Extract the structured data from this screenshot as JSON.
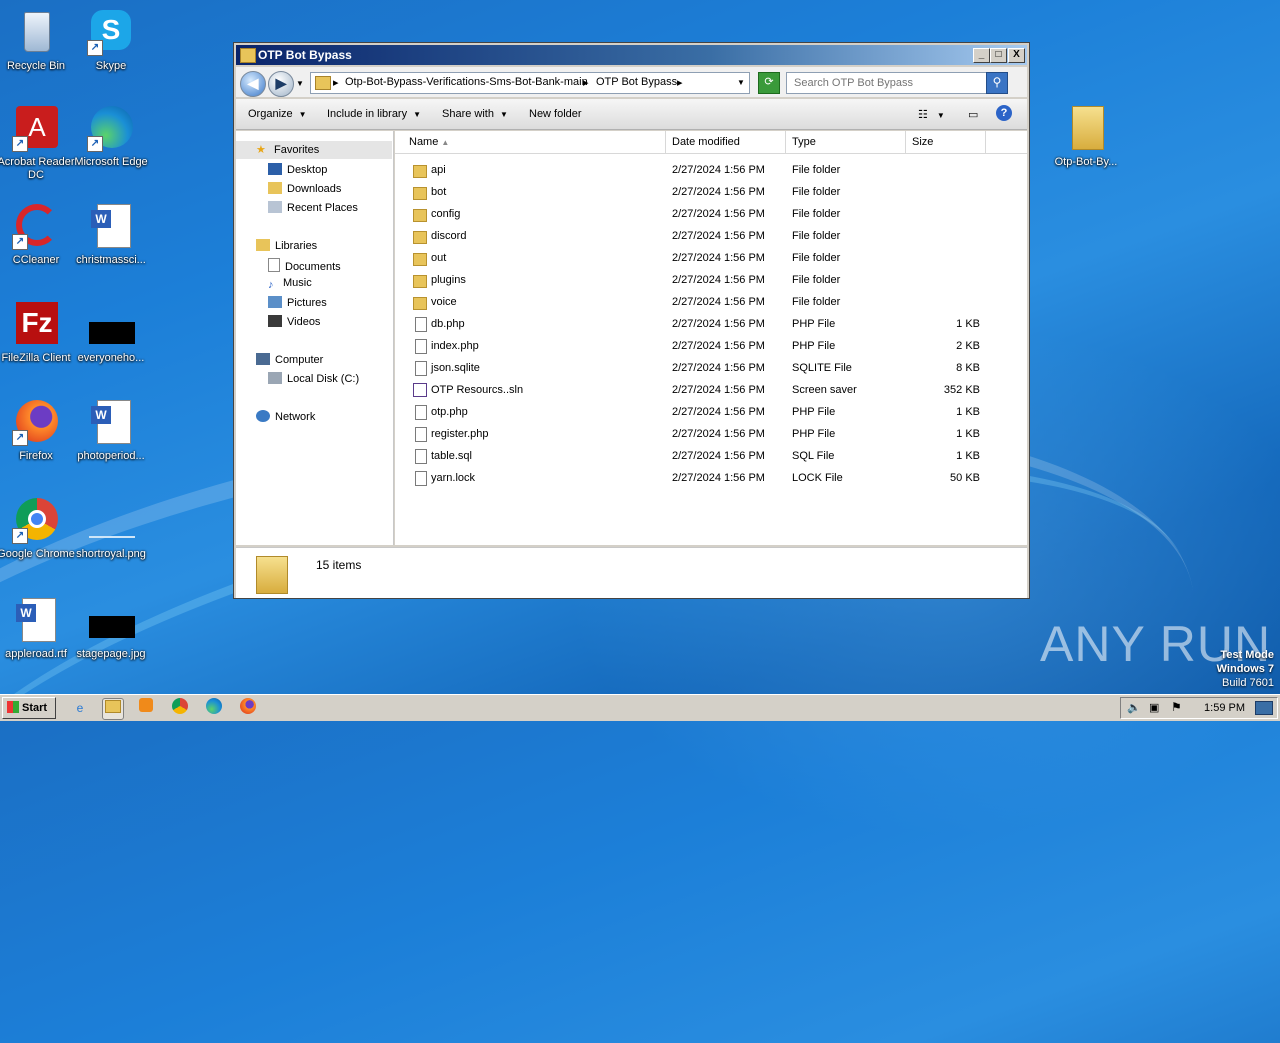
{
  "desktop": {
    "icons": [
      {
        "label": "Recycle Bin"
      },
      {
        "label": "Skype"
      },
      {
        "label": "Acrobat Reader DC"
      },
      {
        "label": "Microsoft Edge"
      },
      {
        "label": "CCleaner"
      },
      {
        "label": "christmassci..."
      },
      {
        "label": "FileZilla Client"
      },
      {
        "label": "everyoneho..."
      },
      {
        "label": "Firefox"
      },
      {
        "label": "photoperiod..."
      },
      {
        "label": "Google Chrome"
      },
      {
        "label": "shortroyal.png"
      },
      {
        "label": "appleroad.rtf"
      },
      {
        "label": "stagepage.jpg"
      },
      {
        "label": "Otp-Bot-By..."
      }
    ],
    "watermark": "ANY RUN",
    "test_mode": {
      "line1": "Test Mode",
      "line2": "Windows 7",
      "line3": "Build 7601"
    }
  },
  "window": {
    "title": "OTP Bot Bypass",
    "buttons": {
      "minimize": "_",
      "maximize": "□",
      "close": "X"
    },
    "address": {
      "crumbs": [
        "Otp-Bot-Bypass-Verifications-Sms-Bot-Bank-main",
        "OTP Bot Bypass"
      ],
      "separator": "▸"
    },
    "search": {
      "placeholder": "Search OTP Bot Bypass"
    },
    "toolbar": {
      "organize": "Organize",
      "include": "Include in library",
      "share": "Share with",
      "new_folder": "New folder"
    },
    "nav": {
      "favorites": "Favorites",
      "desktop": "Desktop",
      "downloads": "Downloads",
      "recent": "Recent Places",
      "libraries": "Libraries",
      "documents": "Documents",
      "music": "Music",
      "pictures": "Pictures",
      "videos": "Videos",
      "computer": "Computer",
      "local_disk": "Local Disk (C:)",
      "network": "Network"
    },
    "columns": {
      "name": "Name",
      "date": "Date modified",
      "type": "Type",
      "size": "Size"
    },
    "files": [
      {
        "name": "api",
        "date": "2/27/2024 1:56 PM",
        "type": "File folder",
        "size": "",
        "kind": "folder"
      },
      {
        "name": "bot",
        "date": "2/27/2024 1:56 PM",
        "type": "File folder",
        "size": "",
        "kind": "folder"
      },
      {
        "name": "config",
        "date": "2/27/2024 1:56 PM",
        "type": "File folder",
        "size": "",
        "kind": "folder"
      },
      {
        "name": "discord",
        "date": "2/27/2024 1:56 PM",
        "type": "File folder",
        "size": "",
        "kind": "folder"
      },
      {
        "name": "out",
        "date": "2/27/2024 1:56 PM",
        "type": "File folder",
        "size": "",
        "kind": "folder"
      },
      {
        "name": "plugins",
        "date": "2/27/2024 1:56 PM",
        "type": "File folder",
        "size": "",
        "kind": "folder"
      },
      {
        "name": "voice",
        "date": "2/27/2024 1:56 PM",
        "type": "File folder",
        "size": "",
        "kind": "folder"
      },
      {
        "name": "db.php",
        "date": "2/27/2024 1:56 PM",
        "type": "PHP File",
        "size": "1 KB",
        "kind": "doc"
      },
      {
        "name": "index.php",
        "date": "2/27/2024 1:56 PM",
        "type": "PHP File",
        "size": "2 KB",
        "kind": "doc"
      },
      {
        "name": "json.sqlite",
        "date": "2/27/2024 1:56 PM",
        "type": "SQLITE File",
        "size": "8 KB",
        "kind": "doc"
      },
      {
        "name": "OTP Resourcs..sln",
        "date": "2/27/2024 1:56 PM",
        "type": "Screen saver",
        "size": "352 KB",
        "kind": "scr"
      },
      {
        "name": "otp.php",
        "date": "2/27/2024 1:56 PM",
        "type": "PHP File",
        "size": "1 KB",
        "kind": "doc"
      },
      {
        "name": "register.php",
        "date": "2/27/2024 1:56 PM",
        "type": "PHP File",
        "size": "1 KB",
        "kind": "doc"
      },
      {
        "name": "table.sql",
        "date": "2/27/2024 1:56 PM",
        "type": "SQL File",
        "size": "1 KB",
        "kind": "doc"
      },
      {
        "name": "yarn.lock",
        "date": "2/27/2024 1:56 PM",
        "type": "LOCK File",
        "size": "50 KB",
        "kind": "doc"
      }
    ],
    "status": {
      "count": "15 items"
    }
  },
  "taskbar": {
    "start": "Start",
    "clock": "1:59 PM"
  }
}
